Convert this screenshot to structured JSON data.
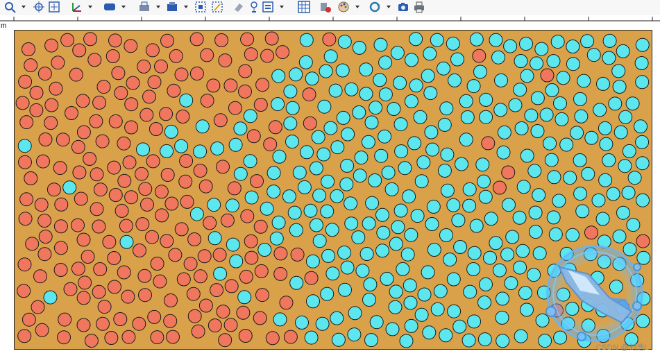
{
  "toolbar": {
    "buttons": [
      {
        "name": "zoom-icon",
        "dropdown": true
      },
      {
        "name": "pan-icon",
        "dropdown": false
      },
      {
        "name": "fit-view-icon",
        "dropdown": false
      },
      {
        "name": "axes-icon",
        "dropdown": true
      },
      {
        "name": "shape-style-icon",
        "dropdown": true
      },
      {
        "name": "print-preview-icon",
        "dropdown": true
      },
      {
        "name": "render-mode-icon",
        "dropdown": true
      },
      {
        "name": "select-region-icon",
        "dropdown": false
      },
      {
        "name": "edit-region-icon",
        "dropdown": false
      },
      {
        "name": "eraser-icon",
        "dropdown": false
      },
      {
        "name": "probe-icon",
        "dropdown": false
      },
      {
        "name": "export-view-icon",
        "dropdown": true
      },
      {
        "name": "grid-icon",
        "dropdown": false
      },
      {
        "name": "clear-plot-icon",
        "dropdown": false
      },
      {
        "name": "palette-icon",
        "dropdown": true
      },
      {
        "name": "refresh-icon",
        "dropdown": true
      },
      {
        "name": "camera-icon",
        "dropdown": false
      },
      {
        "name": "printer-icon",
        "dropdown": false
      }
    ]
  },
  "ruler": {
    "unit_label": "m"
  },
  "particles": {
    "colors": {
      "red": "#f0765e",
      "cyan": "#5ce6ee",
      "background": "#d9a24a",
      "outline": "#1a1a1a"
    },
    "count": 600,
    "seed": 1234
  },
  "watermark": {
    "text": "CSDN @刘浩L"
  }
}
